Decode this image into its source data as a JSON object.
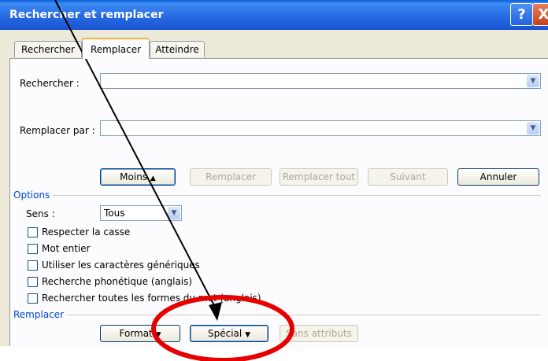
{
  "window": {
    "title": "Rechercher et remplacer",
    "help_glyph": "?",
    "close_glyph": "X"
  },
  "tabs": [
    {
      "label": "Rechercher"
    },
    {
      "label": "Remplacer"
    },
    {
      "label": "Atteindre"
    }
  ],
  "find": {
    "label": "Rechercher :",
    "value": ""
  },
  "replace": {
    "label": "Remplacer par :",
    "value": ""
  },
  "buttons": {
    "less": "Moins",
    "replace": "Remplacer",
    "replace_all": "Remplacer tout",
    "next": "Suivant",
    "cancel": "Annuler"
  },
  "options": {
    "group_label": "Options",
    "direction_label": "Sens :",
    "direction_value": "Tous",
    "checkboxes": [
      {
        "label": "Respecter la casse",
        "checked": false
      },
      {
        "label": "Mot entier",
        "checked": false
      },
      {
        "label": "Utiliser les caractères génériques",
        "checked": false
      },
      {
        "label": "Recherche phonétique (anglais)",
        "checked": false
      },
      {
        "label": "Rechercher toutes les formes du mot (anglais)",
        "checked": false
      }
    ]
  },
  "replace_group": {
    "group_label": "Remplacer",
    "format": "Format",
    "special": "Spécial",
    "no_attributes": "Sans attributs"
  },
  "colors": {
    "titlebar": "#2669e2",
    "group_label": "#0046d5",
    "annotation": "#e60000"
  }
}
